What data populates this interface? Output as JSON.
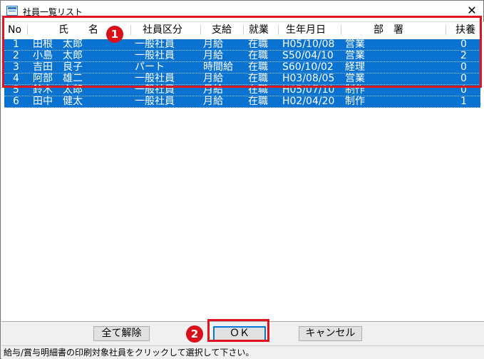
{
  "window": {
    "title": "社員一覧リスト",
    "close_glyph": "✕"
  },
  "table": {
    "columns": [
      "No",
      "氏　　名",
      "社員区分",
      "支給",
      "就業",
      "生年月日",
      "部　署",
      "扶養"
    ],
    "rows": [
      {
        "no": "1",
        "name": "田根　太郎",
        "category": "一般社員",
        "pay": "月給",
        "status": "在職",
        "birth": "H05/10/08",
        "dept": "営業",
        "dependents": "0"
      },
      {
        "no": "2",
        "name": "小島　太郎",
        "category": "一般社員",
        "pay": "月給",
        "status": "在職",
        "birth": "S50/04/10",
        "dept": "営業",
        "dependents": "2"
      },
      {
        "no": "3",
        "name": "吉田　良子",
        "category": "パート",
        "pay": "時間給",
        "status": "在職",
        "birth": "S60/10/02",
        "dept": "経理",
        "dependents": "0"
      },
      {
        "no": "4",
        "name": "阿部　雄二",
        "category": "一般社員",
        "pay": "月給",
        "status": "在職",
        "birth": "H03/08/05",
        "dept": "営業",
        "dependents": "0"
      },
      {
        "no": "5",
        "name": "鈴木　太郎",
        "category": "一般社員",
        "pay": "月給",
        "status": "在職",
        "birth": "H05/07/10",
        "dept": "制作",
        "dependents": "0"
      },
      {
        "no": "6",
        "name": "田中　健太",
        "category": "一般社員",
        "pay": "月給",
        "status": "在職",
        "birth": "H02/04/20",
        "dept": "制作",
        "dependents": "1"
      }
    ]
  },
  "buttons": {
    "clear_all": "全て解除",
    "ok": "ＯＫ",
    "cancel": "キャンセル"
  },
  "status": {
    "message": "給与/賞与明細書の印刷対象社員をクリックして選択して下さい。"
  },
  "annotations": {
    "marker1": "1",
    "marker2": "2",
    "highlight_color": "#e0141e",
    "selection_color": "#0a73d2"
  }
}
